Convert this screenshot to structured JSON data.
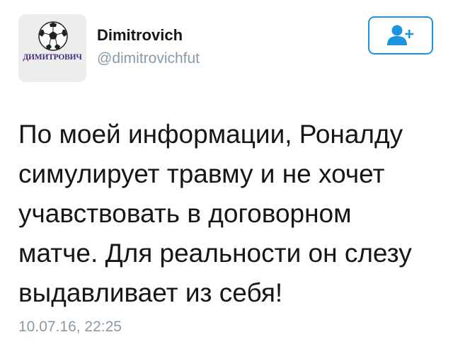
{
  "profile": {
    "display_name": "Dimitrovich",
    "handle": "@dimitrovichfut",
    "avatar_brand_text": "ДИМИТРОВИЧ",
    "avatar_icon": "soccer-ball-icon"
  },
  "follow_button": {
    "icon": "add-user-icon",
    "accent_color": "#1b95e0"
  },
  "tweet": {
    "text": "По моей информации, Роналду\nсимулирует травму и не хочет\nучавствовать в договорном\nматче. Для реальности он слезу\nвыдавливает из себя!",
    "timestamp": "10.07.16, 22:25"
  },
  "colors": {
    "text_primary": "#14171a",
    "text_secondary": "#8899a6",
    "brand_purple": "#4a2a7a",
    "avatar_bg": "#ededee"
  }
}
